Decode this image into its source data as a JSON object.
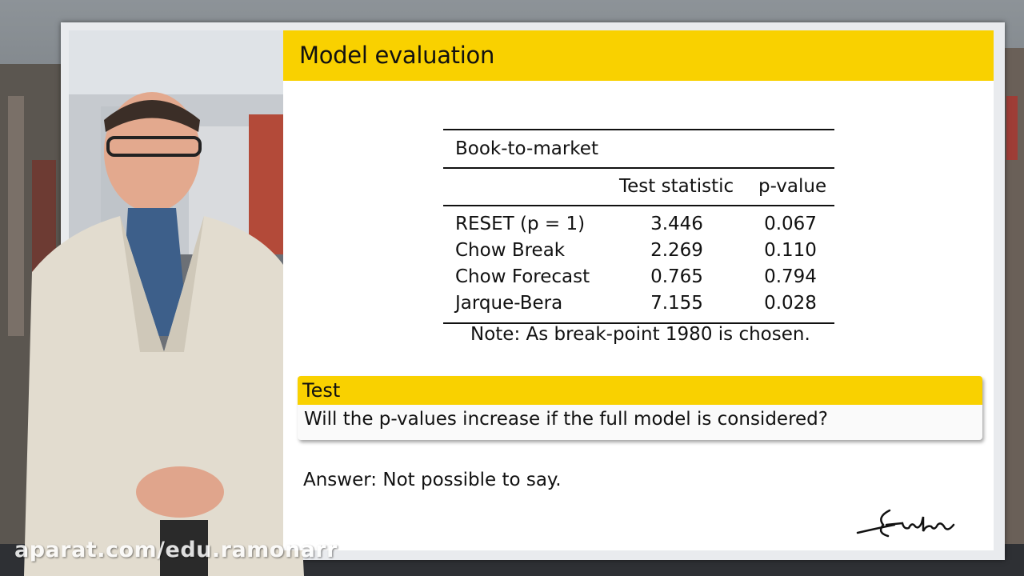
{
  "slide": {
    "title": "Model evaluation",
    "table": {
      "caption": "Book-to-market",
      "headers": [
        "",
        "Test statistic",
        "p-value"
      ],
      "rows": [
        {
          "test": "RESET (p = 1)",
          "statistic": "3.446",
          "p_value": "0.067"
        },
        {
          "test": "Chow Break",
          "statistic": "2.269",
          "p_value": "0.110"
        },
        {
          "test": "Chow Forecast",
          "statistic": "0.765",
          "p_value": "0.794"
        },
        {
          "test": "Jarque-Bera",
          "statistic": "7.155",
          "p_value": "0.028"
        }
      ],
      "note": "Note: As break-point 1980 is chosen."
    },
    "test_block": {
      "title": "Test",
      "question": "Will the p-values increase if the full model is considered?"
    },
    "answer": "Answer: Not possible to say.",
    "colors": {
      "accent": "#f9d100",
      "slide_bg": "#ffffff"
    }
  },
  "watermark": "aparat.com/edu.ramonarr"
}
